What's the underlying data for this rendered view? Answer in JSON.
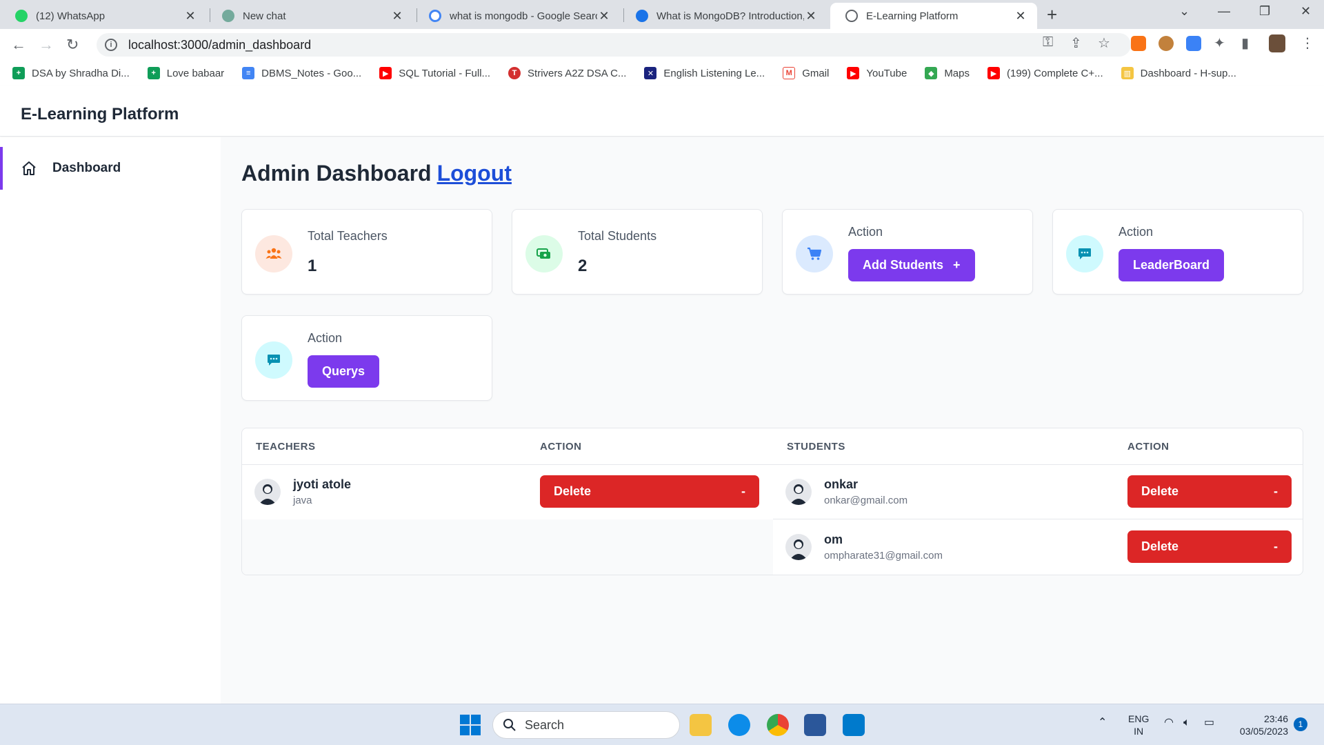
{
  "browser": {
    "tabs": [
      {
        "title": "(12) WhatsApp",
        "favicon": "whatsapp-icon",
        "color": "#25d366"
      },
      {
        "title": "New chat",
        "favicon": "chatgpt-icon",
        "color": "#74aa9c"
      },
      {
        "title": "what is mongodb - Google Searc",
        "favicon": "google-icon",
        "color": "#4285f4"
      },
      {
        "title": "What is MongoDB? Introduction,",
        "favicon": "globe-icon",
        "color": "#1a73e8"
      },
      {
        "title": "E-Learning Platform",
        "favicon": "globe-icon",
        "color": "#5f6368"
      }
    ],
    "url": "localhost:3000/admin_dashboard",
    "bookmarks": [
      {
        "label": "DSA by Shradha Di...",
        "color": "#0f9d58",
        "glyph": "+"
      },
      {
        "label": "Love babaar",
        "color": "#0f9d58",
        "glyph": "+"
      },
      {
        "label": "DBMS_Notes - Goo...",
        "color": "#4285f4",
        "glyph": "≡"
      },
      {
        "label": "SQL Tutorial - Full...",
        "color": "#ff0000",
        "glyph": "▶"
      },
      {
        "label": "Strivers A2Z DSA C...",
        "color": "#d32f2f",
        "glyph": "T"
      },
      {
        "label": "English Listening Le...",
        "color": "#1a237e",
        "glyph": "✕"
      },
      {
        "label": "Gmail",
        "color": "#ea4335",
        "glyph": "M"
      },
      {
        "label": "YouTube",
        "color": "#ff0000",
        "glyph": "▶"
      },
      {
        "label": "Maps",
        "color": "#34a853",
        "glyph": "◆"
      },
      {
        "label": "(199) Complete C+...",
        "color": "#ff0000",
        "glyph": "▶"
      },
      {
        "label": "Dashboard - H-sup...",
        "color": "#f4c542",
        "glyph": "▥"
      }
    ]
  },
  "app": {
    "brand": "E-Learning Platform",
    "sidebar": [
      {
        "label": "Dashboard",
        "icon": "home-icon"
      }
    ],
    "page_title": "Admin Dashboard",
    "logout_label": "Logout",
    "accent": "#7c3aed",
    "cards": [
      {
        "label": "Total Teachers",
        "value": "1",
        "icon": "users-icon",
        "icon_bg": "#fde8e0",
        "icon_color": "#f97316"
      },
      {
        "label": "Total Students",
        "value": "2",
        "icon": "money-icon",
        "icon_bg": "#dcfce7",
        "icon_color": "#16a34a"
      },
      {
        "label": "Action",
        "button": "Add Students",
        "button_suffix": "+",
        "icon": "cart-icon",
        "icon_bg": "#dbeafe",
        "icon_color": "#3b82f6"
      },
      {
        "label": "Action",
        "button": "LeaderBoard",
        "icon": "chat-icon",
        "icon_bg": "#cffafe",
        "icon_color": "#0891b2"
      },
      {
        "label": "Action",
        "button": "Querys",
        "icon": "chat-icon",
        "icon_bg": "#cffafe",
        "icon_color": "#0891b2"
      }
    ],
    "table": {
      "headers": [
        "TEACHERS",
        "ACTION",
        "STUDENTS",
        "ACTION"
      ],
      "teachers": [
        {
          "name": "jyoti atole",
          "subject": "java",
          "action": "Delete",
          "action_suffix": "-"
        }
      ],
      "students": [
        {
          "name": "onkar",
          "email": "onkar@gmail.com",
          "action": "Delete",
          "action_suffix": "-"
        },
        {
          "name": "om",
          "email": "ompharate31@gmail.com",
          "action": "Delete",
          "action_suffix": "-"
        }
      ],
      "danger": "#dc2626"
    }
  },
  "taskbar": {
    "search_label": "Search",
    "language": "ENG",
    "region": "IN",
    "time": "23:46",
    "date": "03/05/2023",
    "notification_count": "1"
  }
}
